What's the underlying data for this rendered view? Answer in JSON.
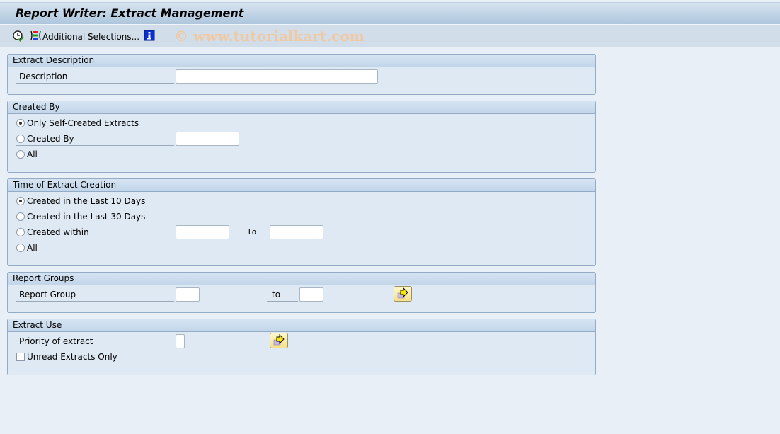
{
  "window": {
    "title": "Report Writer: Extract Management"
  },
  "toolbar": {
    "execute_icon": "execute-clock-icon",
    "additional_selections_label": "Additional Selections...",
    "info_icon": "info-icon",
    "watermark": "© www.tutorialkart.com"
  },
  "groups": {
    "extract_description": {
      "title": "Extract Description",
      "description_label": "Description",
      "description_value": ""
    },
    "created_by": {
      "title": "Created By",
      "options": [
        {
          "label": "Only Self-Created Extracts",
          "selected": true
        },
        {
          "label": "Created By",
          "selected": false
        },
        {
          "label": "All",
          "selected": false
        }
      ],
      "created_by_value": ""
    },
    "time_of_creation": {
      "title": "Time of Extract Creation",
      "options": [
        {
          "label": "Created in the Last 10 Days",
          "selected": true
        },
        {
          "label": "Created in the Last 30 Days",
          "selected": false
        },
        {
          "label": "Created within",
          "selected": false
        },
        {
          "label": "All",
          "selected": false
        }
      ],
      "from_value": "",
      "to_label": "To",
      "to_value": ""
    },
    "report_groups": {
      "title": "Report Groups",
      "report_group_label": "Report Group",
      "from_value": "",
      "to_label": "to",
      "to_value": ""
    },
    "extract_use": {
      "title": "Extract Use",
      "priority_label": "Priority of extract",
      "priority_value": "",
      "unread_label": "Unread Extracts Only",
      "unread_checked": false
    }
  }
}
